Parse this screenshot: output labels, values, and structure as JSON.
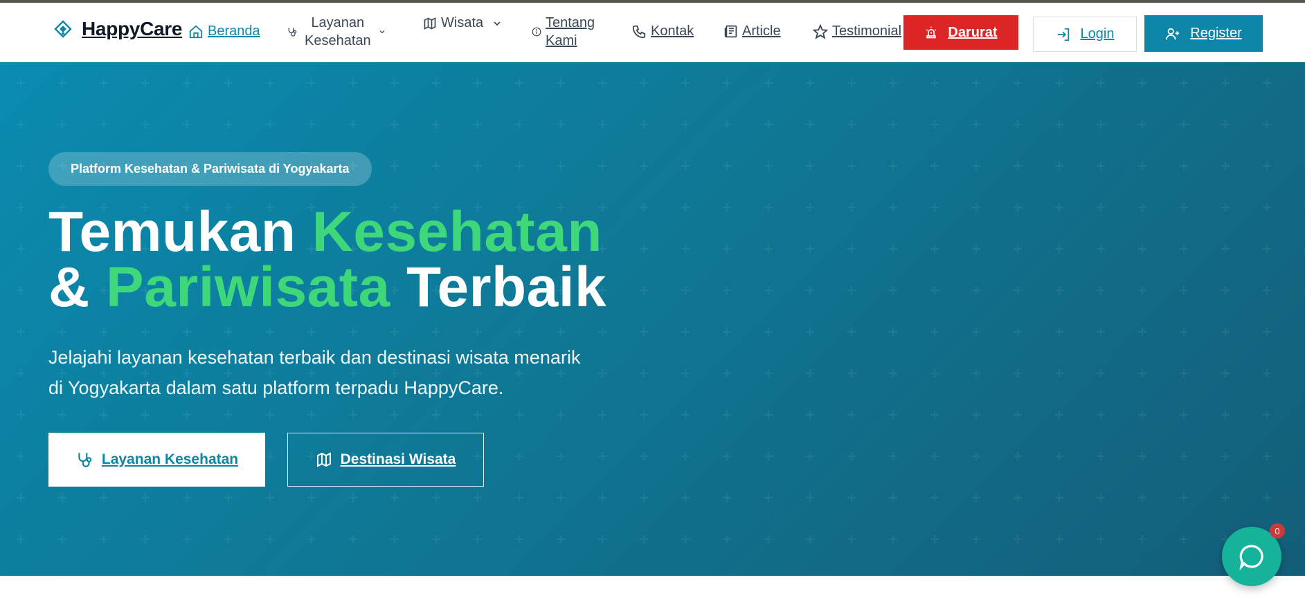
{
  "brand": {
    "name": "HappyCare"
  },
  "nav": {
    "items": [
      {
        "label": "Beranda",
        "icon": "home-icon"
      },
      {
        "label_line1": "Layanan",
        "label_line2": "Kesehatan",
        "icon": "stethoscope-icon"
      },
      {
        "label": "Wisata",
        "icon": "map-icon"
      },
      {
        "label_line1": "Tentang",
        "label_line2": "Kami",
        "icon": "info-icon"
      },
      {
        "label": "Kontak",
        "icon": "phone-icon"
      },
      {
        "label": "Article",
        "icon": "newspaper-icon"
      },
      {
        "label": "Testimonial",
        "icon": "star-icon"
      }
    ],
    "darurat_label": "Darurat",
    "login_label": "Login",
    "register_label": "Register"
  },
  "hero": {
    "badge": "Platform Kesehatan & Pariwisata di Yogyakarta",
    "headline": {
      "w1": "Temukan",
      "w2": "Kesehatan",
      "w3": "&",
      "w4": "Pariwisata",
      "w5": "Terbaik"
    },
    "subtext_line1": "Jelajahi layanan kesehatan terbaik dan destinasi wisata menarik",
    "subtext_line2": "di Yogyakarta dalam satu platform terpadu HappyCare.",
    "cta_health": "Layanan Kesehatan",
    "cta_travel": "Destinasi Wisata"
  },
  "chat": {
    "unread_count": "0"
  },
  "colors": {
    "primary": "#0e86a8",
    "accent_green": "#3ed77a",
    "danger": "#dc2626",
    "chat_fab": "#14b39a"
  }
}
